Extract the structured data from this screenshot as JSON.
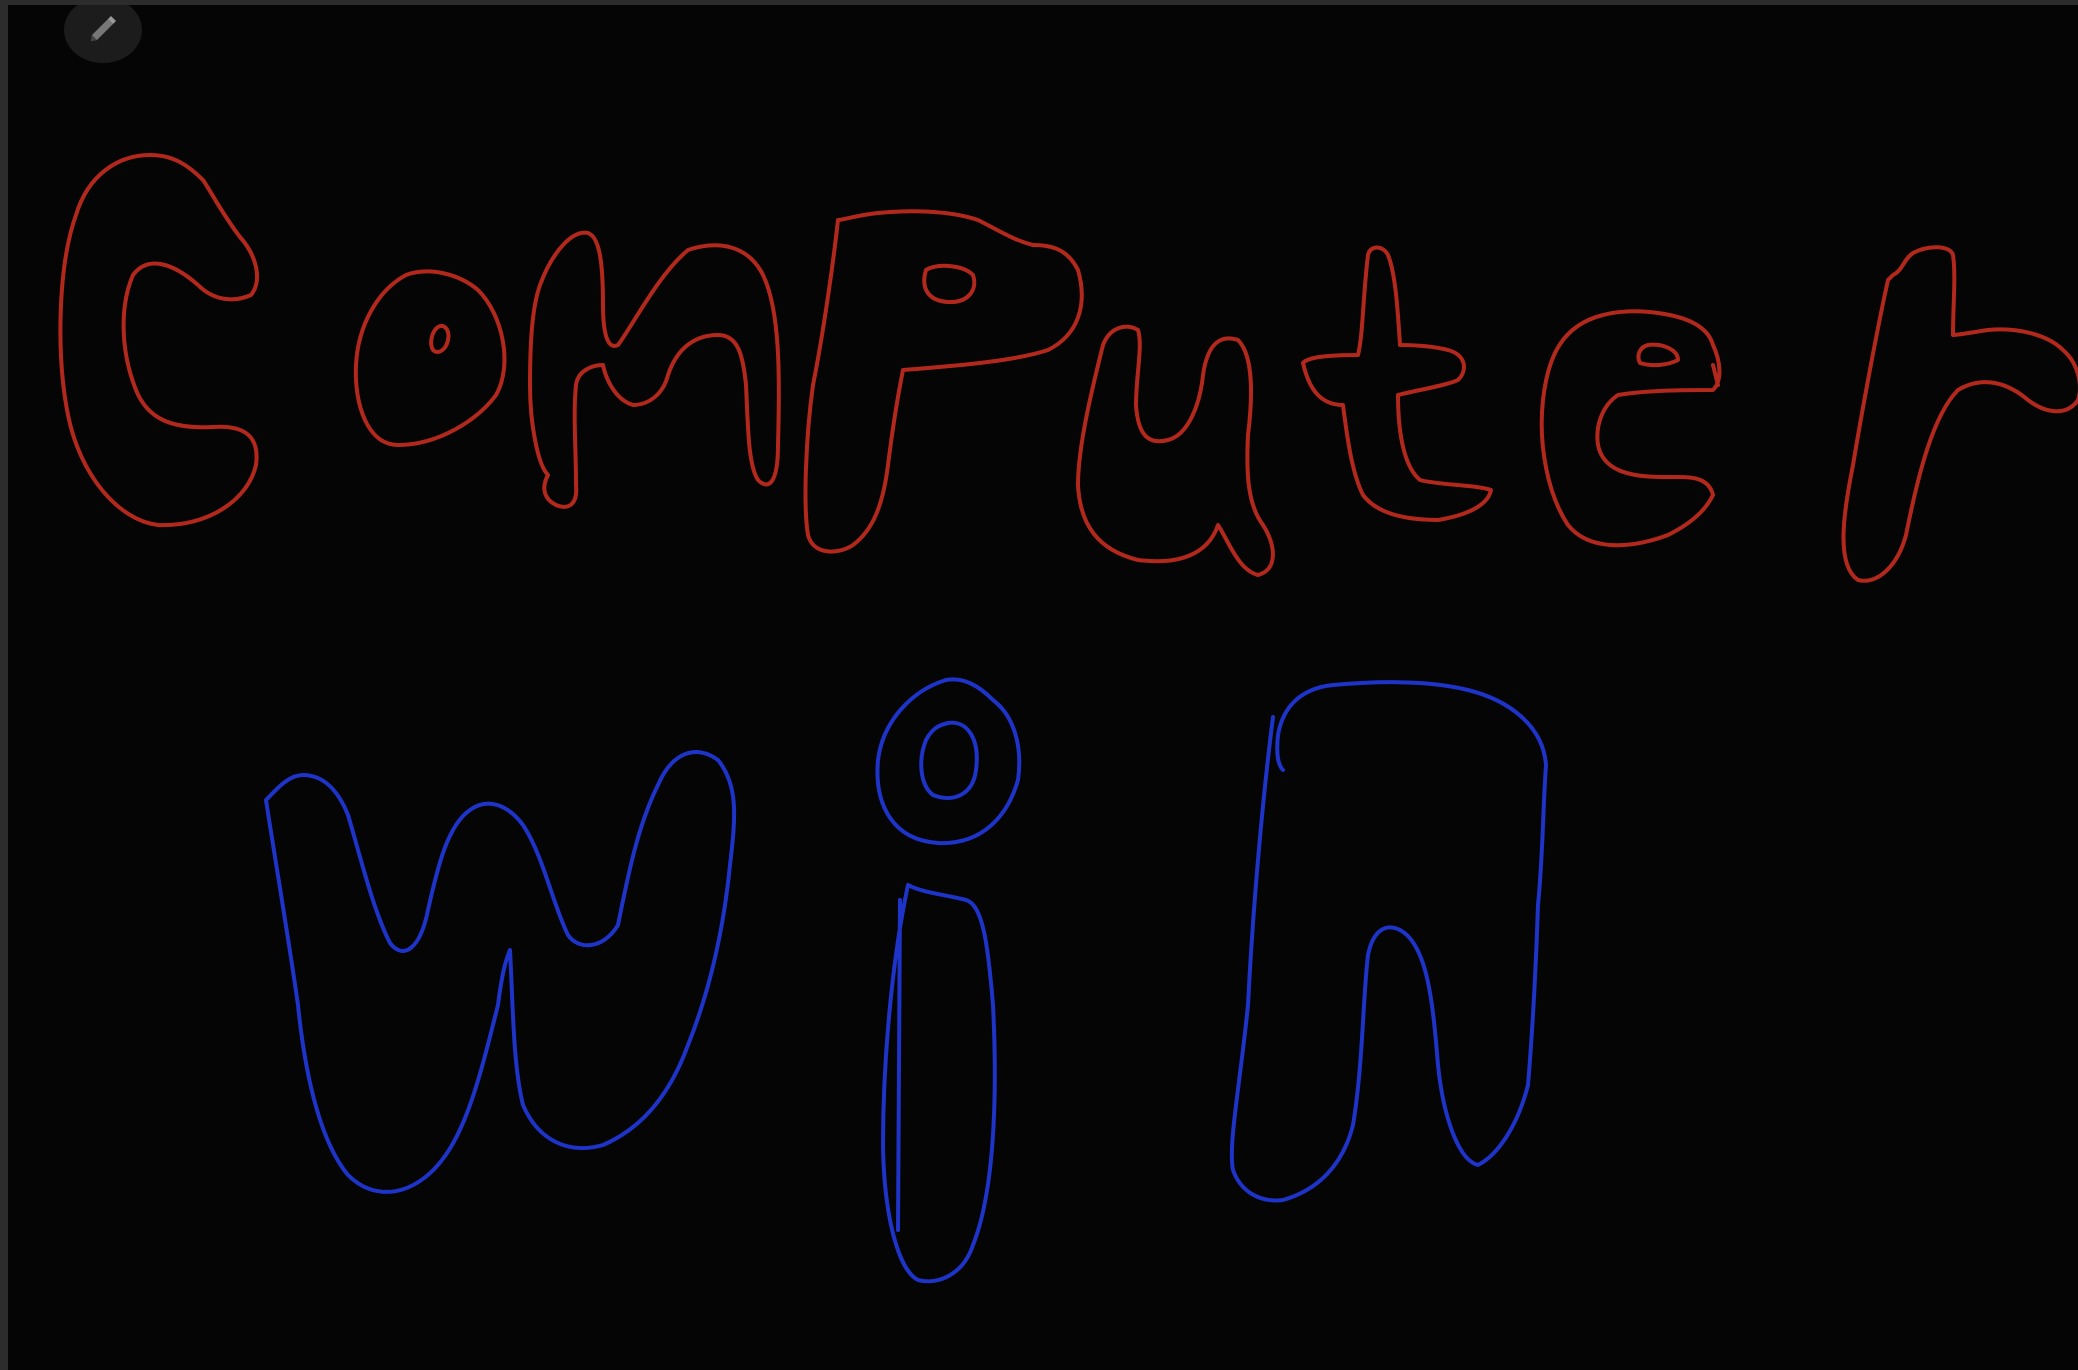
{
  "toolbar": {
    "pen_tool_icon": "pencil-icon"
  },
  "drawing": {
    "line1": {
      "text": "Computer",
      "color": "#b3281c"
    },
    "line2": {
      "text": "win",
      "color": "#1e33c8"
    }
  },
  "colors": {
    "frame": "#2c2c2c",
    "canvas_background": "#050505"
  }
}
